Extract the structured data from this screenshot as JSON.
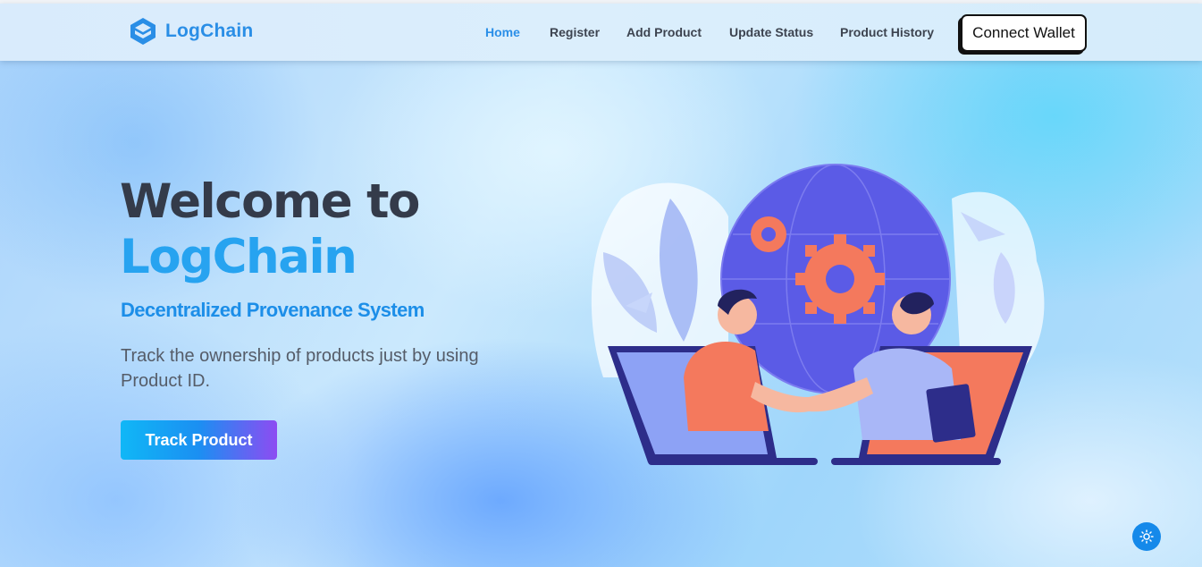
{
  "brand": {
    "name": "LogChain",
    "logo_icon": "cube-icon",
    "color": "#2a8ee6"
  },
  "nav": {
    "items": [
      {
        "label": "Home",
        "active": true
      },
      {
        "label": "Register",
        "active": false
      },
      {
        "label": "Add Product",
        "active": false
      },
      {
        "label": "Update Status",
        "active": false
      },
      {
        "label": "Product History",
        "active": false
      }
    ],
    "wallet_button": "Connect Wallet"
  },
  "hero": {
    "title": "Welcome to",
    "brand": "LogChain",
    "subtitle": "Decentralized Provenance System",
    "description": "Track the ownership of products just by using Product ID.",
    "cta": "Track Product",
    "illustration": "handshake-globe-illustration"
  },
  "theme_toggle": {
    "icon": "sun-icon"
  },
  "colors": {
    "accent": "#2b8fe8",
    "heading": "#343b4a",
    "cta_gradient_start": "#10b7f6",
    "cta_gradient_end": "#8d4cf2"
  }
}
